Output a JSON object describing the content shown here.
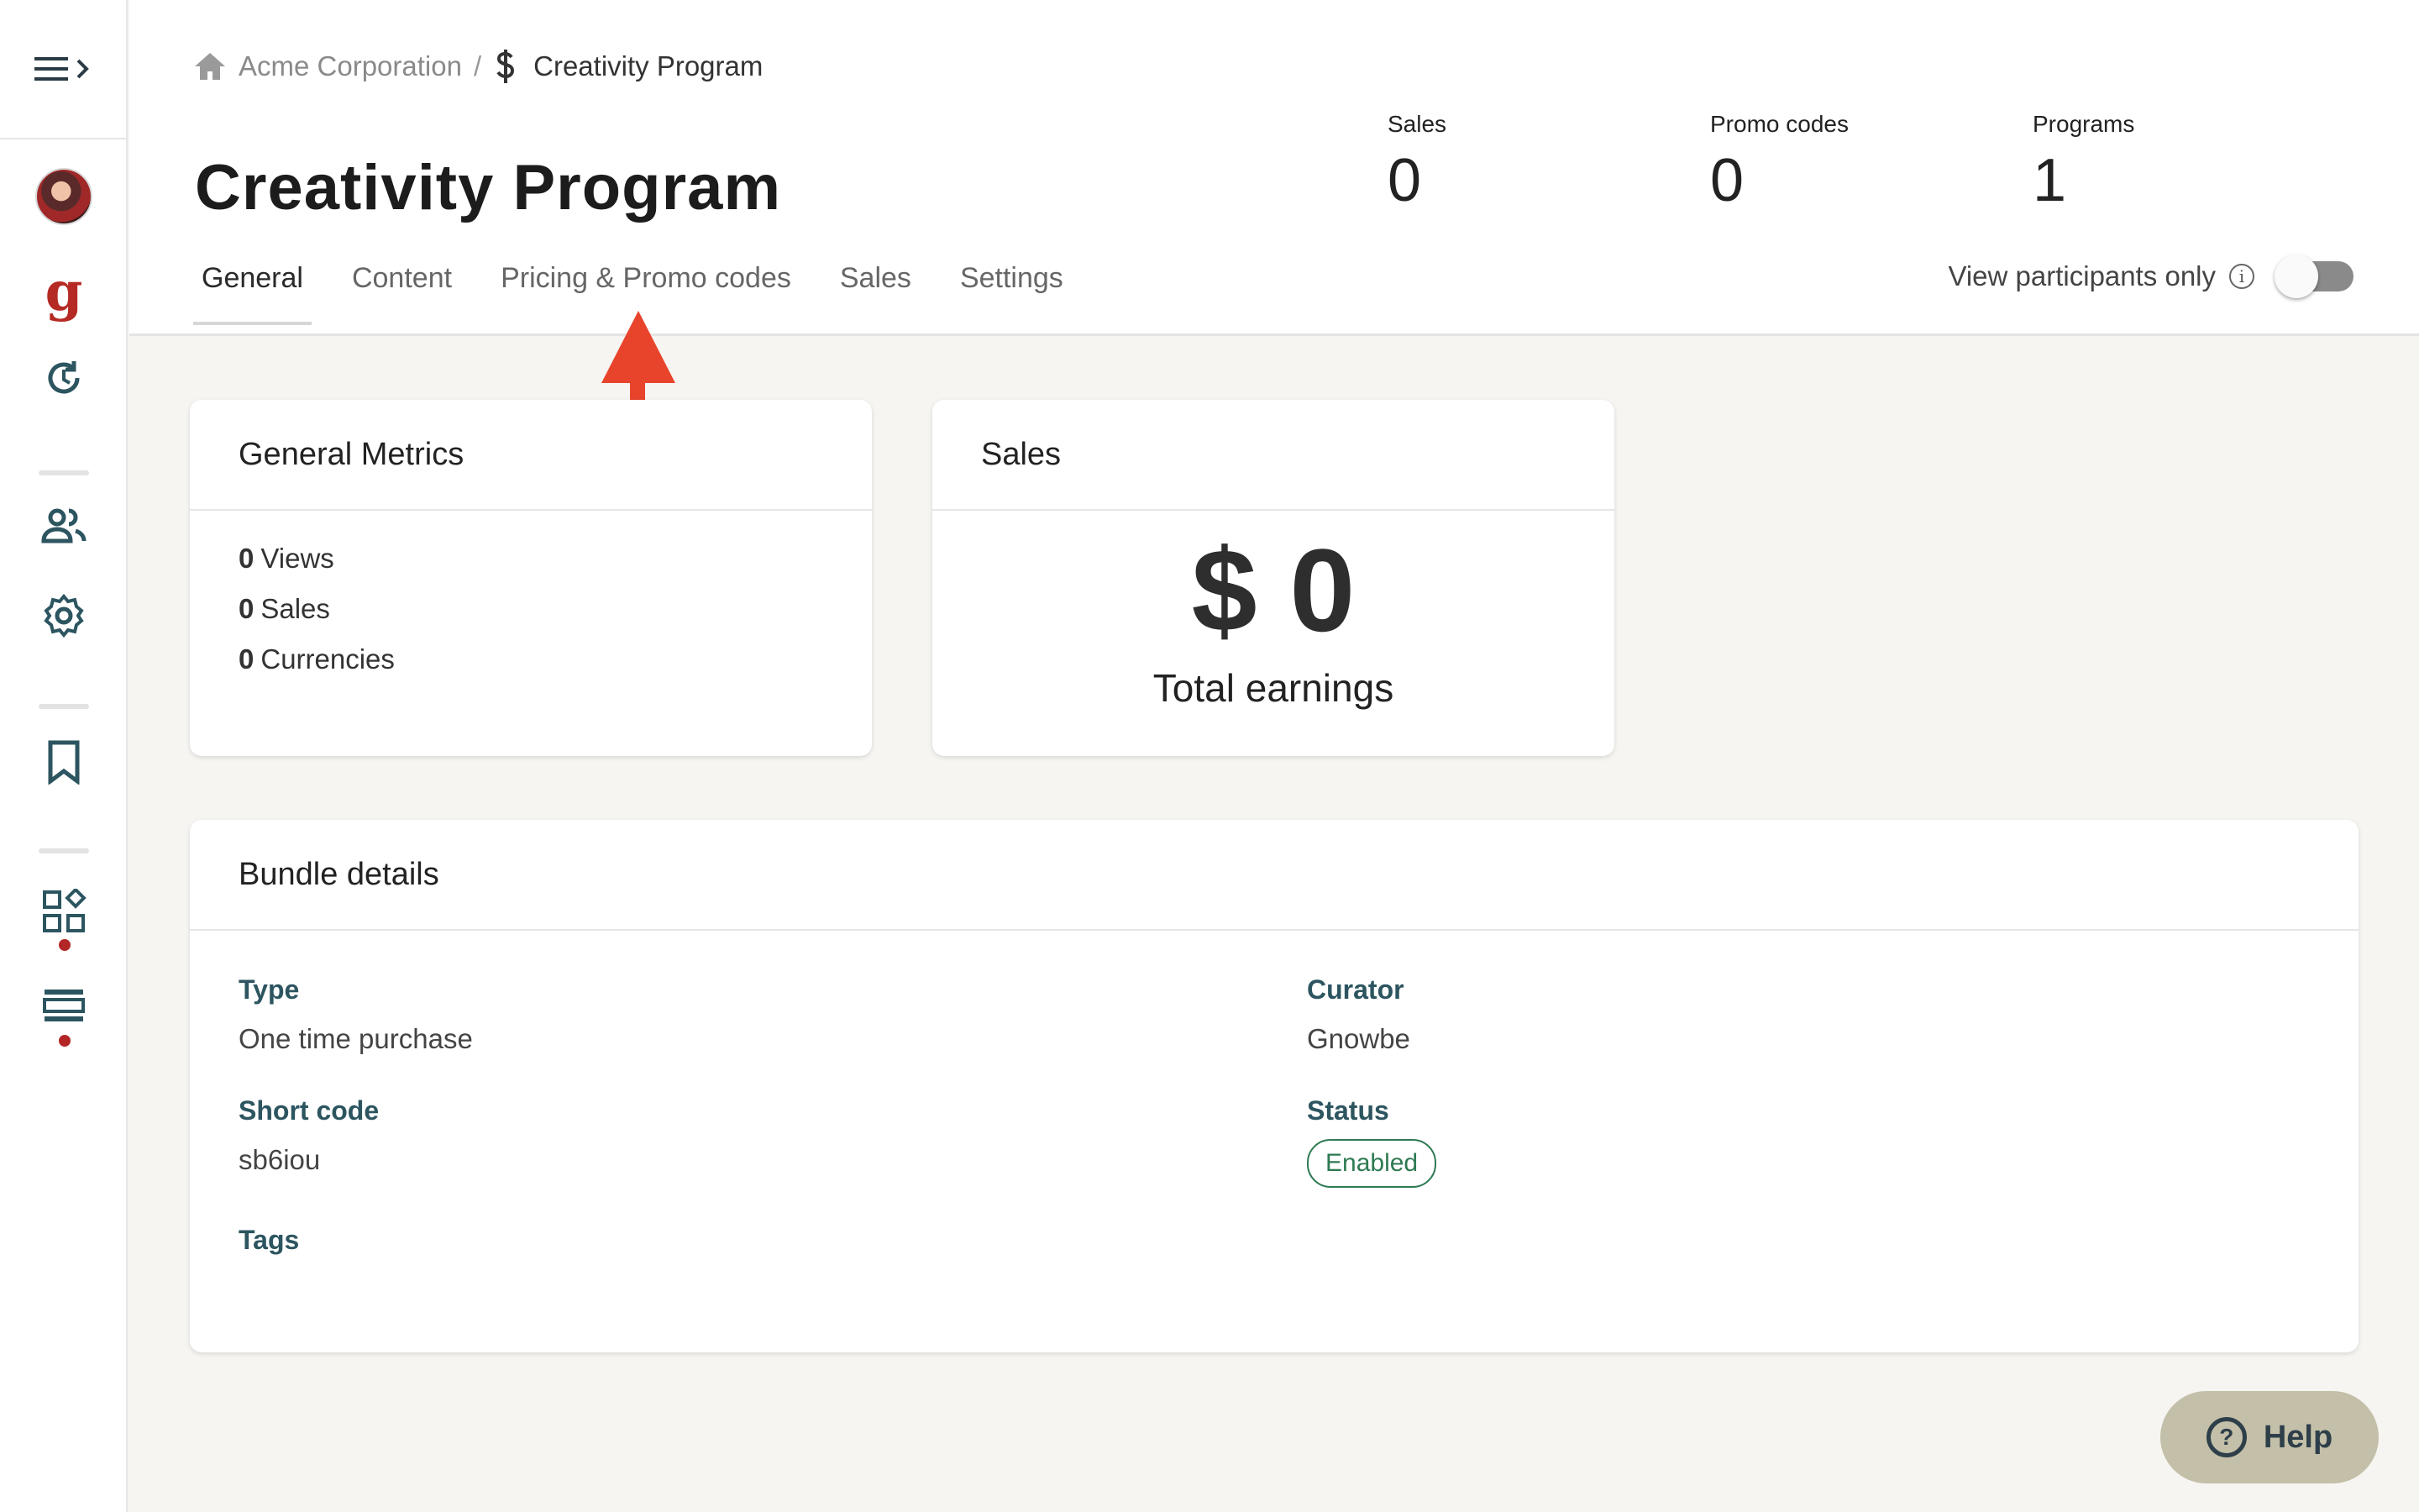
{
  "breadcrumb": {
    "root": "Acme Corporation",
    "separator": "/",
    "current": "Creativity Program"
  },
  "page": {
    "title": "Creativity Program"
  },
  "stats": [
    {
      "label": "Sales",
      "value": "0"
    },
    {
      "label": "Promo codes",
      "value": "0"
    },
    {
      "label": "Programs",
      "value": "1"
    }
  ],
  "tabs": [
    {
      "label": "General",
      "active": true
    },
    {
      "label": "Content",
      "active": false
    },
    {
      "label": "Pricing & Promo codes",
      "active": false
    },
    {
      "label": "Sales",
      "active": false
    },
    {
      "label": "Settings",
      "active": false
    }
  ],
  "participants_toggle": {
    "label": "View participants only",
    "checked": false
  },
  "general_metrics": {
    "title": "General Metrics",
    "lines": [
      {
        "value": "0",
        "label": "Views"
      },
      {
        "value": "0",
        "label": "Sales"
      },
      {
        "value": "0",
        "label": "Currencies"
      }
    ]
  },
  "sales_card": {
    "title": "Sales",
    "value": "$ 0",
    "label": "Total earnings"
  },
  "bundle": {
    "title": "Bundle details",
    "type_label": "Type",
    "type_value": "One time purchase",
    "short_code_label": "Short code",
    "short_code_value": "sb6iou",
    "tags_label": "Tags",
    "curator_label": "Curator",
    "curator_value": "Gnowbe",
    "status_label": "Status",
    "status_value": "Enabled"
  },
  "help": {
    "label": "Help"
  },
  "icons": {
    "menu": "hamburger-menu-icon",
    "home": "home-icon",
    "dollar": "dollar-icon",
    "refresh": "history-icon",
    "people": "people-icon",
    "settings": "gear-icon",
    "bookmark": "bookmark-icon",
    "apps": "apps-icon",
    "layout": "layout-icon"
  },
  "colors": {
    "accent_teal": "#2c5560",
    "brand_red": "#b52a24",
    "status_green": "#2e7a52",
    "annotation_arrow": "#e8442c",
    "help_bg": "#c4bfa8"
  }
}
